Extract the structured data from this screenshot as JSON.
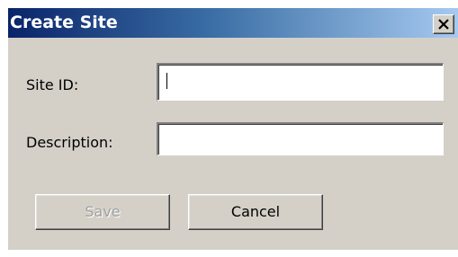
{
  "window": {
    "title": "Create Site",
    "close_icon": "close-x-icon"
  },
  "form": {
    "site_id": {
      "label": "Site ID:",
      "value": "",
      "has_focus": true
    },
    "description": {
      "label": "Description:",
      "value": ""
    }
  },
  "buttons": {
    "save_label": "Save",
    "save_enabled": false,
    "cancel_label": "Cancel"
  },
  "colors": {
    "titlebar_start": "#0a246a",
    "titlebar_end": "#a6caf0",
    "dialog_bg": "#d4d0c8",
    "disabled_text": "#a0a0a0"
  }
}
